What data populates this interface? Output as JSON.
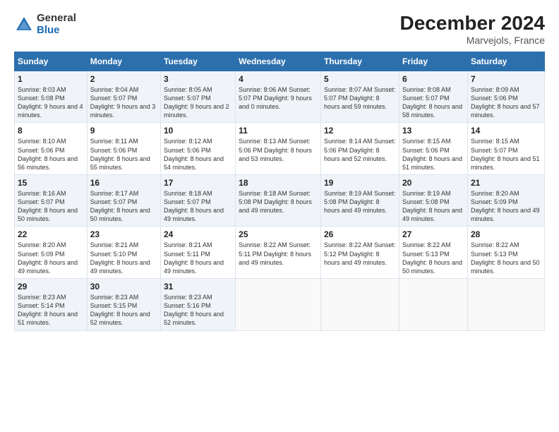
{
  "logo": {
    "general": "General",
    "blue": "Blue"
  },
  "title": "December 2024",
  "subtitle": "Marvejols, France",
  "header_days": [
    "Sunday",
    "Monday",
    "Tuesday",
    "Wednesday",
    "Thursday",
    "Friday",
    "Saturday"
  ],
  "weeks": [
    [
      {
        "day": "1",
        "info": "Sunrise: 8:03 AM\nSunset: 5:08 PM\nDaylight: 9 hours\nand 4 minutes."
      },
      {
        "day": "2",
        "info": "Sunrise: 8:04 AM\nSunset: 5:07 PM\nDaylight: 9 hours\nand 3 minutes."
      },
      {
        "day": "3",
        "info": "Sunrise: 8:05 AM\nSunset: 5:07 PM\nDaylight: 9 hours\nand 2 minutes."
      },
      {
        "day": "4",
        "info": "Sunrise: 8:06 AM\nSunset: 5:07 PM\nDaylight: 9 hours\nand 0 minutes."
      },
      {
        "day": "5",
        "info": "Sunrise: 8:07 AM\nSunset: 5:07 PM\nDaylight: 8 hours\nand 59 minutes."
      },
      {
        "day": "6",
        "info": "Sunrise: 8:08 AM\nSunset: 5:07 PM\nDaylight: 8 hours\nand 58 minutes."
      },
      {
        "day": "7",
        "info": "Sunrise: 8:09 AM\nSunset: 5:06 PM\nDaylight: 8 hours\nand 57 minutes."
      }
    ],
    [
      {
        "day": "8",
        "info": "Sunrise: 8:10 AM\nSunset: 5:06 PM\nDaylight: 8 hours\nand 56 minutes."
      },
      {
        "day": "9",
        "info": "Sunrise: 8:11 AM\nSunset: 5:06 PM\nDaylight: 8 hours\nand 55 minutes."
      },
      {
        "day": "10",
        "info": "Sunrise: 8:12 AM\nSunset: 5:06 PM\nDaylight: 8 hours\nand 54 minutes."
      },
      {
        "day": "11",
        "info": "Sunrise: 8:13 AM\nSunset: 5:06 PM\nDaylight: 8 hours\nand 53 minutes."
      },
      {
        "day": "12",
        "info": "Sunrise: 8:14 AM\nSunset: 5:06 PM\nDaylight: 8 hours\nand 52 minutes."
      },
      {
        "day": "13",
        "info": "Sunrise: 8:15 AM\nSunset: 5:06 PM\nDaylight: 8 hours\nand 51 minutes."
      },
      {
        "day": "14",
        "info": "Sunrise: 8:15 AM\nSunset: 5:07 PM\nDaylight: 8 hours\nand 51 minutes."
      }
    ],
    [
      {
        "day": "15",
        "info": "Sunrise: 8:16 AM\nSunset: 5:07 PM\nDaylight: 8 hours\nand 50 minutes."
      },
      {
        "day": "16",
        "info": "Sunrise: 8:17 AM\nSunset: 5:07 PM\nDaylight: 8 hours\nand 50 minutes."
      },
      {
        "day": "17",
        "info": "Sunrise: 8:18 AM\nSunset: 5:07 PM\nDaylight: 8 hours\nand 49 minutes."
      },
      {
        "day": "18",
        "info": "Sunrise: 8:18 AM\nSunset: 5:08 PM\nDaylight: 8 hours\nand 49 minutes."
      },
      {
        "day": "19",
        "info": "Sunrise: 8:19 AM\nSunset: 5:08 PM\nDaylight: 8 hours\nand 49 minutes."
      },
      {
        "day": "20",
        "info": "Sunrise: 8:19 AM\nSunset: 5:08 PM\nDaylight: 8 hours\nand 49 minutes."
      },
      {
        "day": "21",
        "info": "Sunrise: 8:20 AM\nSunset: 5:09 PM\nDaylight: 8 hours\nand 49 minutes."
      }
    ],
    [
      {
        "day": "22",
        "info": "Sunrise: 8:20 AM\nSunset: 5:09 PM\nDaylight: 8 hours\nand 49 minutes."
      },
      {
        "day": "23",
        "info": "Sunrise: 8:21 AM\nSunset: 5:10 PM\nDaylight: 8 hours\nand 49 minutes."
      },
      {
        "day": "24",
        "info": "Sunrise: 8:21 AM\nSunset: 5:11 PM\nDaylight: 8 hours\nand 49 minutes."
      },
      {
        "day": "25",
        "info": "Sunrise: 8:22 AM\nSunset: 5:11 PM\nDaylight: 8 hours\nand 49 minutes."
      },
      {
        "day": "26",
        "info": "Sunrise: 8:22 AM\nSunset: 5:12 PM\nDaylight: 8 hours\nand 49 minutes."
      },
      {
        "day": "27",
        "info": "Sunrise: 8:22 AM\nSunset: 5:13 PM\nDaylight: 8 hours\nand 50 minutes."
      },
      {
        "day": "28",
        "info": "Sunrise: 8:22 AM\nSunset: 5:13 PM\nDaylight: 8 hours\nand 50 minutes."
      }
    ],
    [
      {
        "day": "29",
        "info": "Sunrise: 8:23 AM\nSunset: 5:14 PM\nDaylight: 8 hours\nand 51 minutes."
      },
      {
        "day": "30",
        "info": "Sunrise: 8:23 AM\nSunset: 5:15 PM\nDaylight: 8 hours\nand 52 minutes."
      },
      {
        "day": "31",
        "info": "Sunrise: 8:23 AM\nSunset: 5:16 PM\nDaylight: 8 hours\nand 52 minutes."
      },
      null,
      null,
      null,
      null
    ]
  ]
}
